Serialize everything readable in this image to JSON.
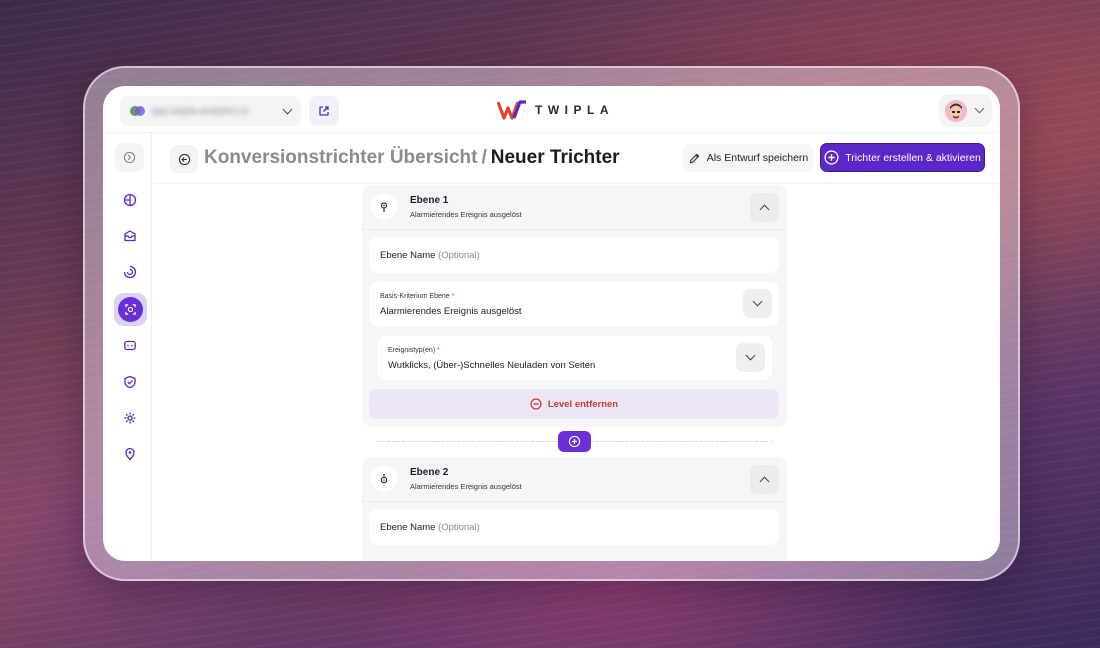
{
  "app": {
    "brand": "TWIPLA",
    "site_selector": {
      "value": "app.twipla-analytics.io"
    }
  },
  "header": {
    "breadcrumb_parent": "Konversionstrichter Übersicht",
    "separator": "/",
    "title": "Neuer Trichter",
    "draft_button": "Als Entwurf speichern",
    "create_button": "Trichter erstellen & aktivieren"
  },
  "sidebar": {
    "items": [
      {
        "icon": "collapse-sidebar-icon"
      },
      {
        "icon": "analytics-globe-icon"
      },
      {
        "icon": "inbox-icon"
      },
      {
        "icon": "session-recording-icon"
      },
      {
        "icon": "funnel-camera-icon",
        "active": true
      },
      {
        "icon": "feedback-chat-icon"
      },
      {
        "icon": "privacy-shield-icon"
      },
      {
        "icon": "settings-gear-icon"
      },
      {
        "icon": "location-pin-icon"
      }
    ]
  },
  "levels": [
    {
      "title": "Ebene 1",
      "subtitle": "Alarmierendes Ereignis ausgelöst",
      "name_placeholder": "Ebene Name",
      "name_optional": "(Optional)",
      "criterion_label": "Basis-Kriterium Ebene",
      "criterion_value": "Alarmierendes Ereignis ausgelöst",
      "event_type_label": "Ereignistyp(en)",
      "event_type_value": "Wutklicks, (Über-)Schnelles Neuladen von Seiten",
      "remove_label": "Level entfernen"
    },
    {
      "title": "Ebene 2",
      "subtitle": "Alarmierendes Ereignis ausgelöst",
      "name_placeholder": "Ebene Name",
      "name_optional": "(Optional)"
    }
  ],
  "required_marker": "*",
  "colors": {
    "accent": "#5a27c9",
    "accent_light": "#ece6f7",
    "danger": "#c2412a",
    "logo_red": "#e0452f"
  }
}
